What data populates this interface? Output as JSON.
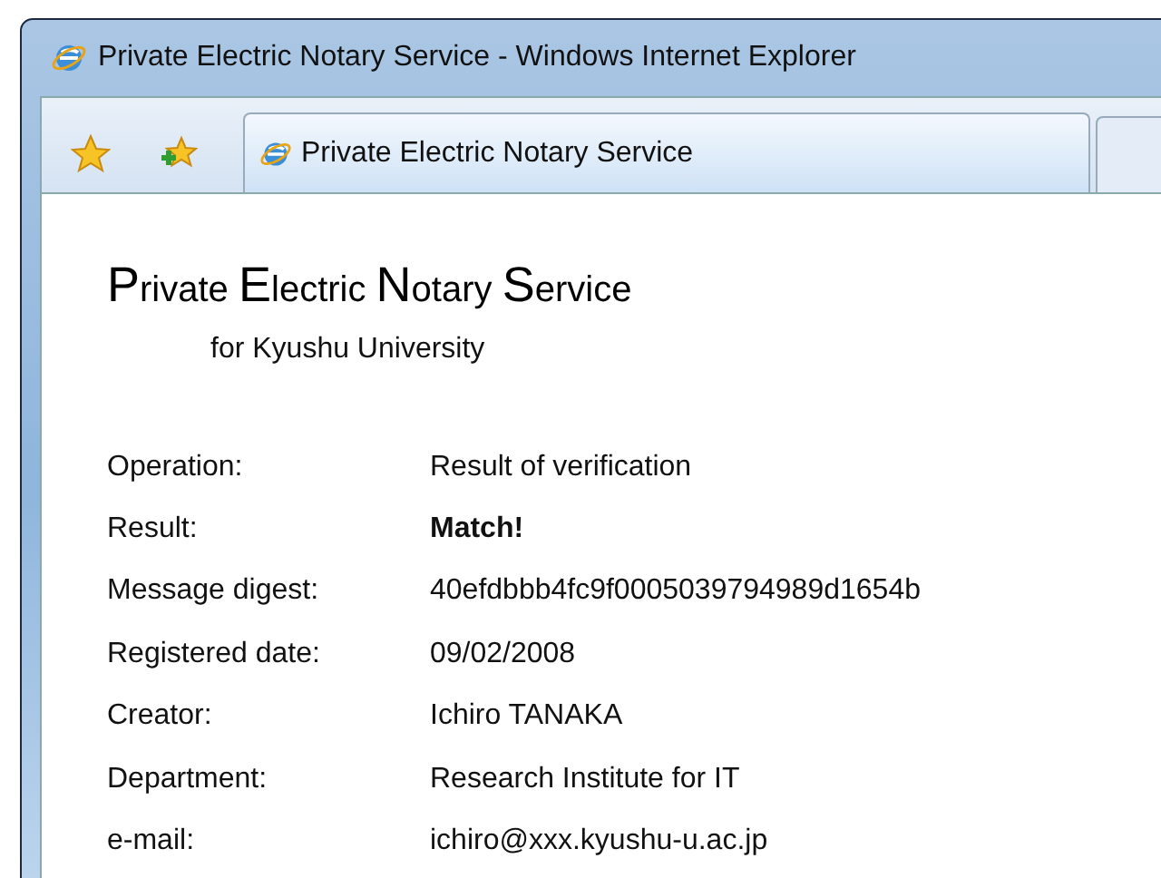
{
  "window": {
    "title": "Private Electric Notary Service - Windows Internet Explorer"
  },
  "tab": {
    "label": "Private Electric Notary Service",
    "selected": true
  },
  "page": {
    "heading": "Private Electric Notary Service",
    "subtitle": "for Kyushu University",
    "fields": [
      {
        "label": "Operation:",
        "value": "Result of verification",
        "bold": false
      },
      {
        "label": "Result:",
        "value": "Match!",
        "bold": true
      },
      {
        "label": "Message digest:",
        "value": "40efdbbb4fc9f0005039794989d1654b",
        "bold": false
      },
      {
        "label": "Registered date:",
        "value": "09/02/2008",
        "bold": false
      },
      {
        "label": "Creator:",
        "value": "Ichiro TANAKA",
        "bold": false
      },
      {
        "label": "Department:",
        "value": "Research Institute for IT",
        "bold": false
      },
      {
        "label": "e-mail:",
        "value": "ichiro@xxx.kyushu-u.ac.jp",
        "bold": false
      }
    ]
  }
}
